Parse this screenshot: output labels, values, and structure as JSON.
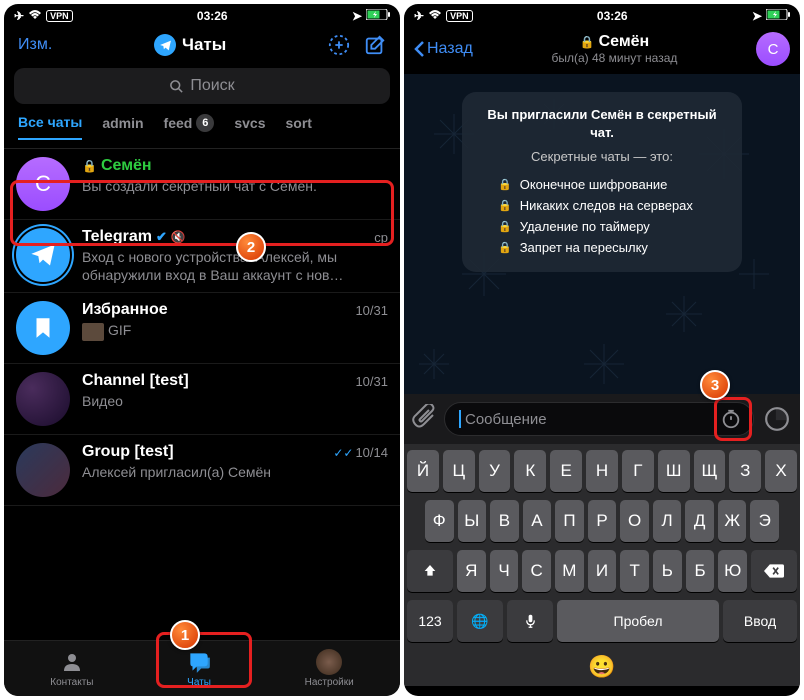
{
  "status": {
    "time": "03:26",
    "vpn": "VPN"
  },
  "left": {
    "edit": "Изм.",
    "title": "Чаты",
    "search_placeholder": "Поиск",
    "filters": [
      {
        "label": "Все чаты",
        "active": true
      },
      {
        "label": "admin"
      },
      {
        "label": "feed",
        "badge": "6"
      },
      {
        "label": "svcs"
      },
      {
        "label": "sort"
      }
    ],
    "chats": [
      {
        "name": "Семён",
        "secret": true,
        "msg": "Вы создали секретный чат с Семён.",
        "date": "",
        "avatar_letter": "C"
      },
      {
        "name": "Telegram",
        "verified": true,
        "muted": true,
        "msg": "Вход с нового устройства. Алексей, мы обнаружили вход в Ваш аккаунт с нов…",
        "date": "ср"
      },
      {
        "name": "Избранное",
        "msg": "GIF",
        "date": "10/31",
        "gif": true
      },
      {
        "name": "Channel [test]",
        "msg": "Видео",
        "date": "10/31"
      },
      {
        "name": "Group [test]",
        "msg": "Алексей пригласил(а) Семён",
        "date": "10/14",
        "read": true
      }
    ],
    "tabs": {
      "contacts": "Контакты",
      "chats": "Чаты",
      "settings": "Настройки"
    }
  },
  "right": {
    "back": "Назад",
    "title": "Семён",
    "subtitle": "был(а) 48 минут назад",
    "avatar_letter": "C",
    "bubble": {
      "title": "Вы пригласили Семён в секретный чат.",
      "subtitle": "Секретные чаты — это:",
      "items": [
        "Оконечное шифрование",
        "Никаких следов на серверах",
        "Удаление по таймеру",
        "Запрет на пересылку"
      ]
    },
    "input_placeholder": "Сообщение",
    "keyboard": {
      "row1": [
        "Й",
        "Ц",
        "У",
        "К",
        "Е",
        "Н",
        "Г",
        "Ш",
        "Щ",
        "З",
        "Х"
      ],
      "row2": [
        "Ф",
        "Ы",
        "В",
        "А",
        "П",
        "Р",
        "О",
        "Л",
        "Д",
        "Ж",
        "Э"
      ],
      "row3": [
        "Я",
        "Ч",
        "С",
        "М",
        "И",
        "Т",
        "Ь",
        "Б",
        "Ю"
      ],
      "num": "123",
      "space": "Пробел",
      "enter": "Ввод"
    }
  },
  "markers": {
    "m1": "1",
    "m2": "2",
    "m3": "3"
  }
}
